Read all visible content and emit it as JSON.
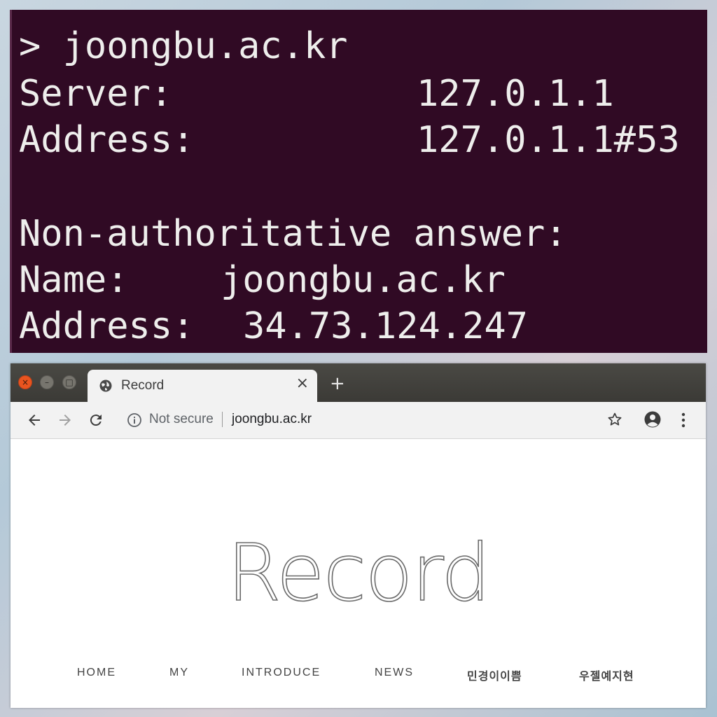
{
  "terminal": {
    "prompt_line": "> joongbu.ac.kr",
    "server_label": "Server:",
    "server_value": "127.0.1.1",
    "address_label": "Address:",
    "address_value": "127.0.1.1#53",
    "answer_heading": "Non-authoritative answer:",
    "name_label": "Name:",
    "name_value": "joongbu.ac.kr",
    "result_label": "Address:",
    "result_value": "34.73.124.247",
    "colors": {
      "background": "#300a24",
      "text": "#eeeeec"
    }
  },
  "browser": {
    "window_buttons": {
      "close": "×",
      "minimize": "–",
      "maximize": "□"
    },
    "tab": {
      "title": "Record",
      "close": "×",
      "icon": "globe-icon"
    },
    "new_tab": "+",
    "toolbar": {
      "security_label": "Not secure",
      "url": "joongbu.ac.kr",
      "icons": [
        "back-arrow-icon",
        "forward-arrow-icon",
        "reload-icon",
        "info-icon",
        "star-icon",
        "account-icon",
        "menu-dots-icon"
      ]
    },
    "page": {
      "title": "Record",
      "nav": [
        "HOME",
        "MY",
        "INTRODUCE",
        "NEWS",
        "민경이이쁨",
        "우젤예지현"
      ]
    }
  }
}
